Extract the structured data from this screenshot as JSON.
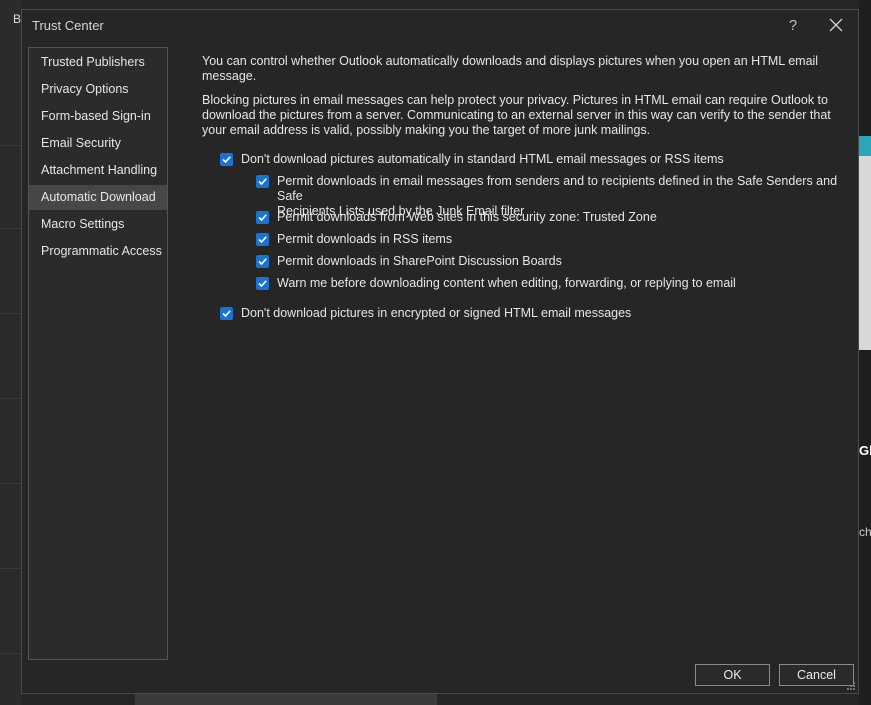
{
  "background": {
    "left_letter": "B",
    "right_text_1": "Gl",
    "right_text_2": "ch",
    "accent_teal": "#2aa6b8"
  },
  "dialog": {
    "title": "Trust Center",
    "help_label": "?",
    "close_icon": "close-icon"
  },
  "sidebar": {
    "items": [
      {
        "label": "Trusted Publishers"
      },
      {
        "label": "Privacy Options"
      },
      {
        "label": "Form-based Sign-in"
      },
      {
        "label": "Email Security"
      },
      {
        "label": "Attachment Handling"
      },
      {
        "label": "Automatic Download",
        "selected": true
      },
      {
        "label": "Macro Settings"
      },
      {
        "label": "Programmatic Access"
      }
    ]
  },
  "content": {
    "intro": "You can control whether Outlook automatically downloads and displays pictures when you open an HTML email message.",
    "privacy_note": "Blocking pictures in email messages can help protect your privacy. Pictures in HTML email can require Outlook to download the pictures from a server. Communicating to an external server in this way can verify to the sender that your email address is valid, possibly making you the target of more junk mailings.",
    "options": {
      "dont_download_auto": {
        "label": "Don't download pictures automatically in standard HTML email messages or RSS items",
        "checked": true
      },
      "permit_safe_senders": {
        "label_line1": "Permit downloads in email messages from senders and to recipients defined in the Safe Senders and Safe",
        "label_line2": "Recipients Lists used by the Junk Email filter",
        "checked": true
      },
      "permit_web_sites": {
        "label": "Permit downloads from Web sites in this security zone: Trusted Zone",
        "checked": true
      },
      "permit_rss": {
        "label": "Permit downloads in RSS items",
        "checked": true
      },
      "permit_sharepoint": {
        "label": "Permit downloads in SharePoint Discussion Boards",
        "checked": true
      },
      "warn_before": {
        "label": "Warn me before downloading content when editing, forwarding, or replying to email",
        "checked": true
      },
      "dont_download_encrypted": {
        "label": "Don't download pictures in encrypted or signed HTML email messages",
        "checked": true
      }
    },
    "checkbox_color": "#1a73d1"
  },
  "footer": {
    "ok_label": "OK",
    "cancel_label": "Cancel"
  }
}
